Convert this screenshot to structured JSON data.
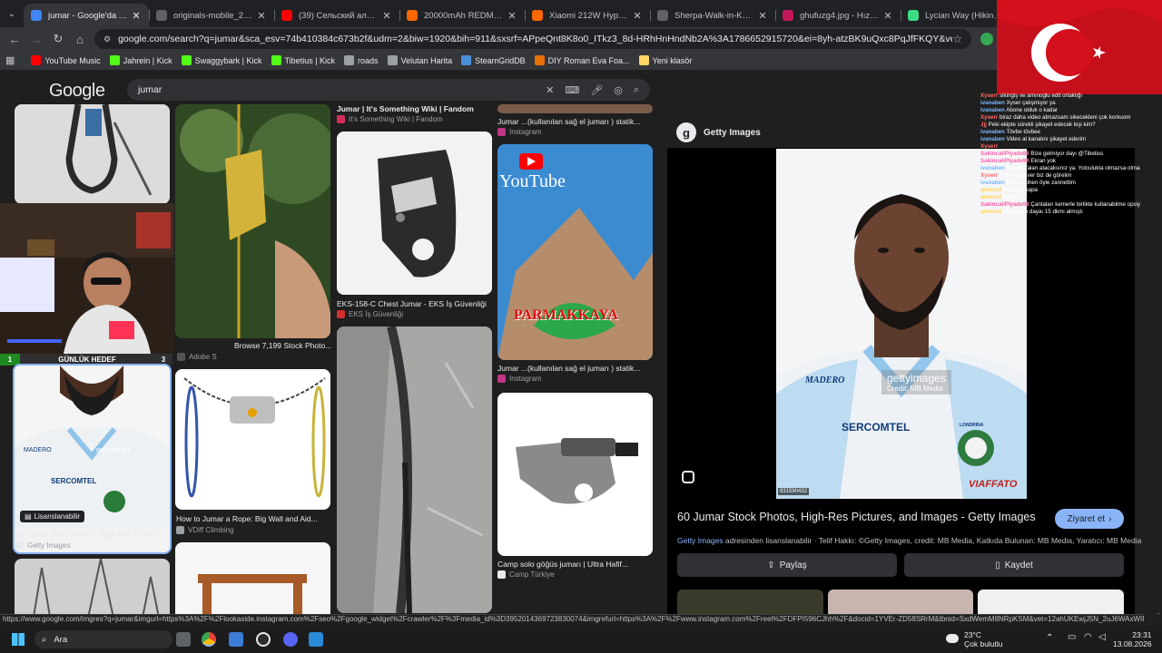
{
  "tabs": [
    {
      "title": "jumar - Google'da Ara",
      "active": true,
      "color": "#4285f4"
    },
    {
      "title": "originals-mobile_2.jpg (1000×...",
      "active": false,
      "color": "#5f6368"
    },
    {
      "title": "(39) Сельский алкаш нап...",
      "active": false,
      "color": "#ff0000"
    },
    {
      "title": "20000mAh REDMI 18W Fa...",
      "active": false,
      "color": "#ff6700"
    },
    {
      "title": "Xiaomi 212W HyperCharg...",
      "active": false,
      "color": "#ff6700"
    },
    {
      "title": "Sherpa-Walk-in-Khumbu...",
      "active": false,
      "color": "#5f6368"
    },
    {
      "title": "ghufuzg4.jpg - Hızlı Resim...",
      "active": false,
      "color": "#c2185b"
    },
    {
      "title": "Lycian Way (Hiking trail",
      "active": false,
      "color": "#3ddc84"
    }
  ],
  "address_url": "google.com/search?q=jumar&sca_esv=74b410384c673b2f&udm=2&biw=1920&bih=911&sxsrf=APpeQnt8K8o0_ITkz3_8d-HRhHnHndNb2A%3A1786652915720&ei=8yh-atzBK9uQxc8PqJfFKQY&ved=0ahUKEwich4PjuJ6...",
  "bookmarks": [
    {
      "label": "YouTube Music",
      "color": "#ff0000"
    },
    {
      "label": "Jahrein | Kick",
      "color": "#53fc18"
    },
    {
      "label": "Swaggybark | Kick",
      "color": "#53fc18"
    },
    {
      "label": "Tibetius | Kick",
      "color": "#53fc18"
    },
    {
      "label": "roads",
      "color": "#9aa0a6"
    },
    {
      "label": "Velutan Harita",
      "color": "#9aa0a6"
    },
    {
      "label": "SteamGridDB",
      "color": "#4a90d9"
    },
    {
      "label": "DIY Roman Eva Foa...",
      "color": "#e8710a"
    },
    {
      "label": "Yeni klasör",
      "color": "#fdd663"
    }
  ],
  "bookmarks_extra": "Jahrein",
  "search": {
    "logo": "Google",
    "query": "jumar"
  },
  "results": {
    "c1_top_cap": "",
    "c2_browse": "Browse 7,199 Stock Photo...",
    "c2_adobe": "Adobe S",
    "c3_top_cap": "Jumar | It's Something Wiki | Fandom",
    "c3_top_src": "It's Something Wiki | Fandom",
    "c3_mid_cap": "EKS-158-C Chest Jumar - EKS İş Güvenliği",
    "c3_mid_src": "EKS İş Güvenliği",
    "c4_top_cap": "Jumar ...(kullanılan sağ el jumarı ) statik...",
    "c4_top_src": "Instagram",
    "c4_mid_cap": "Jumar ...(kullanılan sağ el jumarı ) statik...",
    "c4_mid_src": "Instagram",
    "c4_yt": "YouTube",
    "c4_parmakkaya": "PARMAKKAYA",
    "c4_bot_cap": "Camp solo göğüs jumarı | Ultra Hafif...",
    "c4_bot_src": "Camp Türkiye",
    "c1_sel_badge": "Lisanslanabilir",
    "c1_sel_cap": "60 Jumar Stock Photos, High-Res Picture...",
    "c1_sel_src": "Getty Images",
    "c2_mid_cap": "How to Jumar a Rope: Big Wall and Aid...",
    "c2_mid_src": "VDiff Climbing"
  },
  "panel": {
    "source": "Getty Images",
    "watermark": "gettyimages",
    "credit": "Credit: MB Media",
    "image_id": "831590432",
    "title": "60 Jumar Stock Photos, High-Res Pictures, and Images - Getty Images",
    "visit": "Ziyaret et",
    "meta_src": "Getty Images",
    "meta_rest": " adresinden lisanslanabilir · Telif Hakkı: ©Getty Images, credit: MB Media, Katkıda Bulunan: MB Media, Yaratıcı: MB Media",
    "share": "Paylaş",
    "save": "Kaydet",
    "jersey": {
      "sponsor_top": "MADERO",
      "sponsor_mid": "SERCOMTEL",
      "sponsor_bot": "VIAFFATO",
      "crest": "LONDRINA"
    }
  },
  "goal": {
    "left": "1",
    "label": "GÜNLÜK HEDEF",
    "right": "3"
  },
  "chat": [
    {
      "user": "Xyserr",
      "text": "sikingiş ve amınoglu edit ortaklığı",
      "color": "#ff6b6b"
    },
    {
      "user": "ivanaben",
      "text": "Xyser çalışmıyor ya",
      "color": "#7ab8ff"
    },
    {
      "user": "ivanaben",
      "text": "Abone olduk o kadar",
      "color": "#7ab8ff"
    },
    {
      "user": "Xyserr",
      "text": "biraz daha video atmazsam sikecekleni çok korkuom",
      "color": "#ff6b6b"
    },
    {
      "user": "Jjj",
      "text": "Peki ekipte sürekli şikayet edecek kişi kim?",
      "color": "#ff6b6b"
    },
    {
      "user": "ivanaben",
      "text": "Tövbe tövbee",
      "color": "#7ab8ff"
    },
    {
      "user": "ivanaben",
      "text": "Video at kanalını şikayet ederim",
      "color": "#7ab8ff"
    },
    {
      "user": "Xyserr",
      "text": "",
      "color": "#ff6b6b"
    },
    {
      "user": "SakincaliPiyade98",
      "text": "Bize gelmiyor dayı @Tibetius",
      "color": "#ff5fa8"
    },
    {
      "user": "SakincaliPiyade98",
      "text": "Ekran yok",
      "color": "#ff5fa8"
    },
    {
      "user": "ivanaben",
      "text": "Asıl Jbl falan alacaksınız ya. Yolculukta olmazsa olmaz.",
      "color": "#7ab8ff"
    },
    {
      "user": "Xyserr",
      "text": "dayı ekran ver biz de görelim",
      "color": "#ff6b6b"
    },
    {
      "user": "ivanaben",
      "text": "Ben tercihen öyle zannettim",
      "color": "#7ab8ff"
    },
    {
      "user": "qmeso0",
      "text": "full cami kapa",
      "color": "#ffd36b"
    },
    {
      "user": "qmeso0",
      "text": "bleepier",
      "color": "#ffd36b"
    },
    {
      "user": "SakincaliPiyade98",
      "text": "Çantaları kemerle birlikte kullanabilme opsiyonu var mı?",
      "color": "#ff5fa8"
    },
    {
      "user": "qmeso0",
      "text": "öğrenirsin dayaı 15 dkmı almıştı",
      "color": "#ffd36b"
    }
  ],
  "status_url": "https://www.google.com/imgres?q=jumar&imgurl=https%3A%2F%2Flookaside.instagram.com%2Fseo%2Fgoogle_widget%2Fcrawler%2F%3Fmedia_id%3D3952014369723830074&imgrefurl=https%3A%2F%2Fwww.instagram.com%2Freel%2FDFPI596CJhh%2F&docid=1YVEr-ZD58SRrM&tbnid=SxdWemM8NRpKSM&vet=12ahUKEwjJ5N_2uJ6WAxWIFED...",
  "taskbar": {
    "search": "Ara",
    "temp": "23°C",
    "weather": "Çok bulutlu",
    "time": "23:31",
    "date": "13.08.2026"
  }
}
